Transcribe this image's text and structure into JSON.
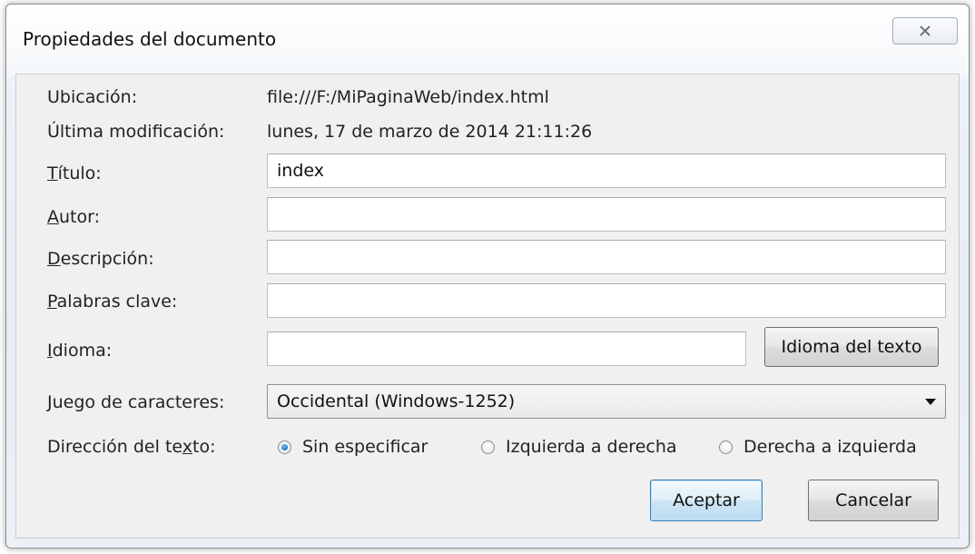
{
  "window": {
    "title": "Propiedades del documento",
    "close_icon": "close-icon"
  },
  "info": {
    "location_label": "Ubicación:",
    "location_value": "file:///F:/MiPaginaWeb/index.html",
    "modified_label": "Última modificación:",
    "modified_value": "lunes, 17 de marzo de 2014 21:11:26"
  },
  "fields": {
    "title": {
      "label_key": "T",
      "label_rest": "ítulo:",
      "value": "index"
    },
    "author": {
      "label_key": "A",
      "label_rest": "utor:",
      "value": ""
    },
    "description": {
      "label_key": "D",
      "label_rest": "escripción:",
      "value": ""
    },
    "keywords": {
      "label_key": "P",
      "label_rest": "alabras clave:",
      "value": ""
    },
    "language": {
      "label_key": "I",
      "label_rest": "dioma:",
      "value": ""
    }
  },
  "language_button": "Idioma del texto",
  "charset": {
    "label": "Juego de caracteres:",
    "selected": "Occidental (Windows-1252)"
  },
  "direction": {
    "label_pre": "Dirección del te",
    "label_key": "x",
    "label_post": "to:",
    "options": [
      {
        "label": "Sin especificar",
        "checked": true
      },
      {
        "label": "Izquierda a derecha",
        "checked": false
      },
      {
        "label": "Derecha a izquierda",
        "checked": false
      }
    ]
  },
  "buttons": {
    "accept": "Aceptar",
    "cancel": "Cancelar"
  }
}
